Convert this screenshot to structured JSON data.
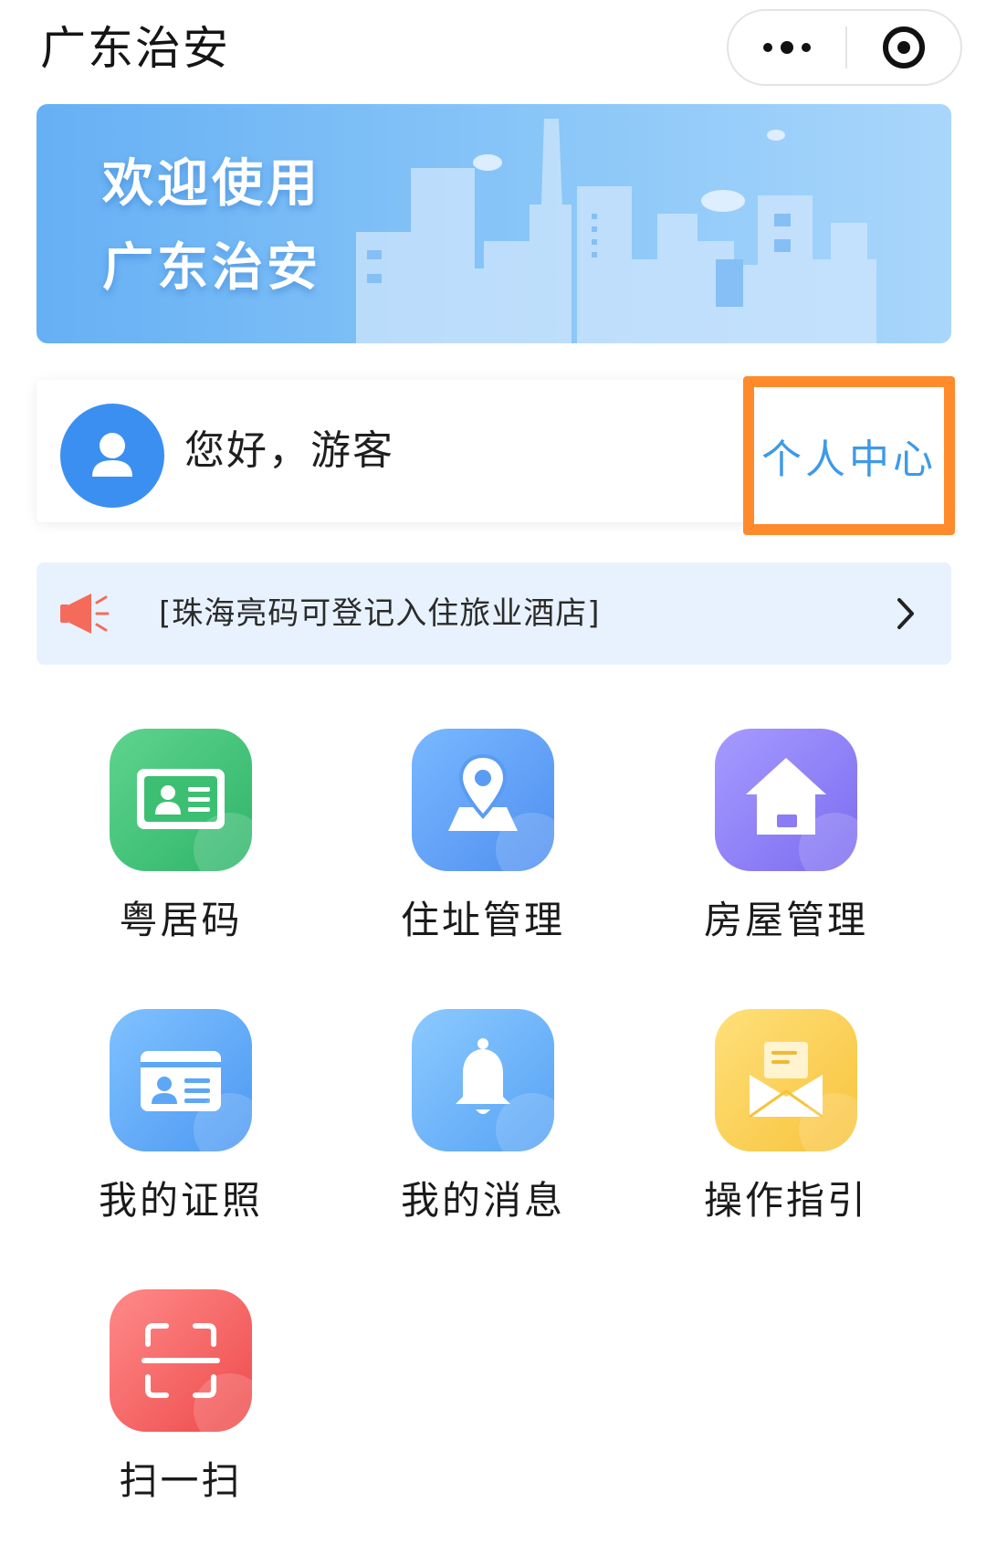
{
  "header": {
    "title": "广东治安",
    "more_icon": "more-dots-icon",
    "close_icon": "target-circle-icon"
  },
  "banner": {
    "line1": "欢迎使用",
    "line2": "广东治安"
  },
  "greeting": {
    "text": "您好，游客",
    "personal_center": "个人中心",
    "highlight_color": "#ff8a2b"
  },
  "notice": {
    "text": "[珠海亮码可登记入住旅业酒店]",
    "icon": "megaphone-icon",
    "arrow_icon": "chevron-right-icon"
  },
  "services": [
    {
      "label": "粤居码",
      "icon": "id-card-icon",
      "color": "#3cc074"
    },
    {
      "label": "住址管理",
      "icon": "location-map-icon",
      "color": "#5a9cf3"
    },
    {
      "label": "房屋管理",
      "icon": "house-icon",
      "color": "#8a7cf4"
    },
    {
      "label": "我的证照",
      "icon": "license-card-icon",
      "color": "#5ea6f6"
    },
    {
      "label": "我的消息",
      "icon": "bell-icon",
      "color": "#63abf7"
    },
    {
      "label": "操作指引",
      "icon": "envelope-icon",
      "color": "#f9cc4a"
    },
    {
      "label": "扫一扫",
      "icon": "scan-icon",
      "color": "#f05656"
    }
  ]
}
